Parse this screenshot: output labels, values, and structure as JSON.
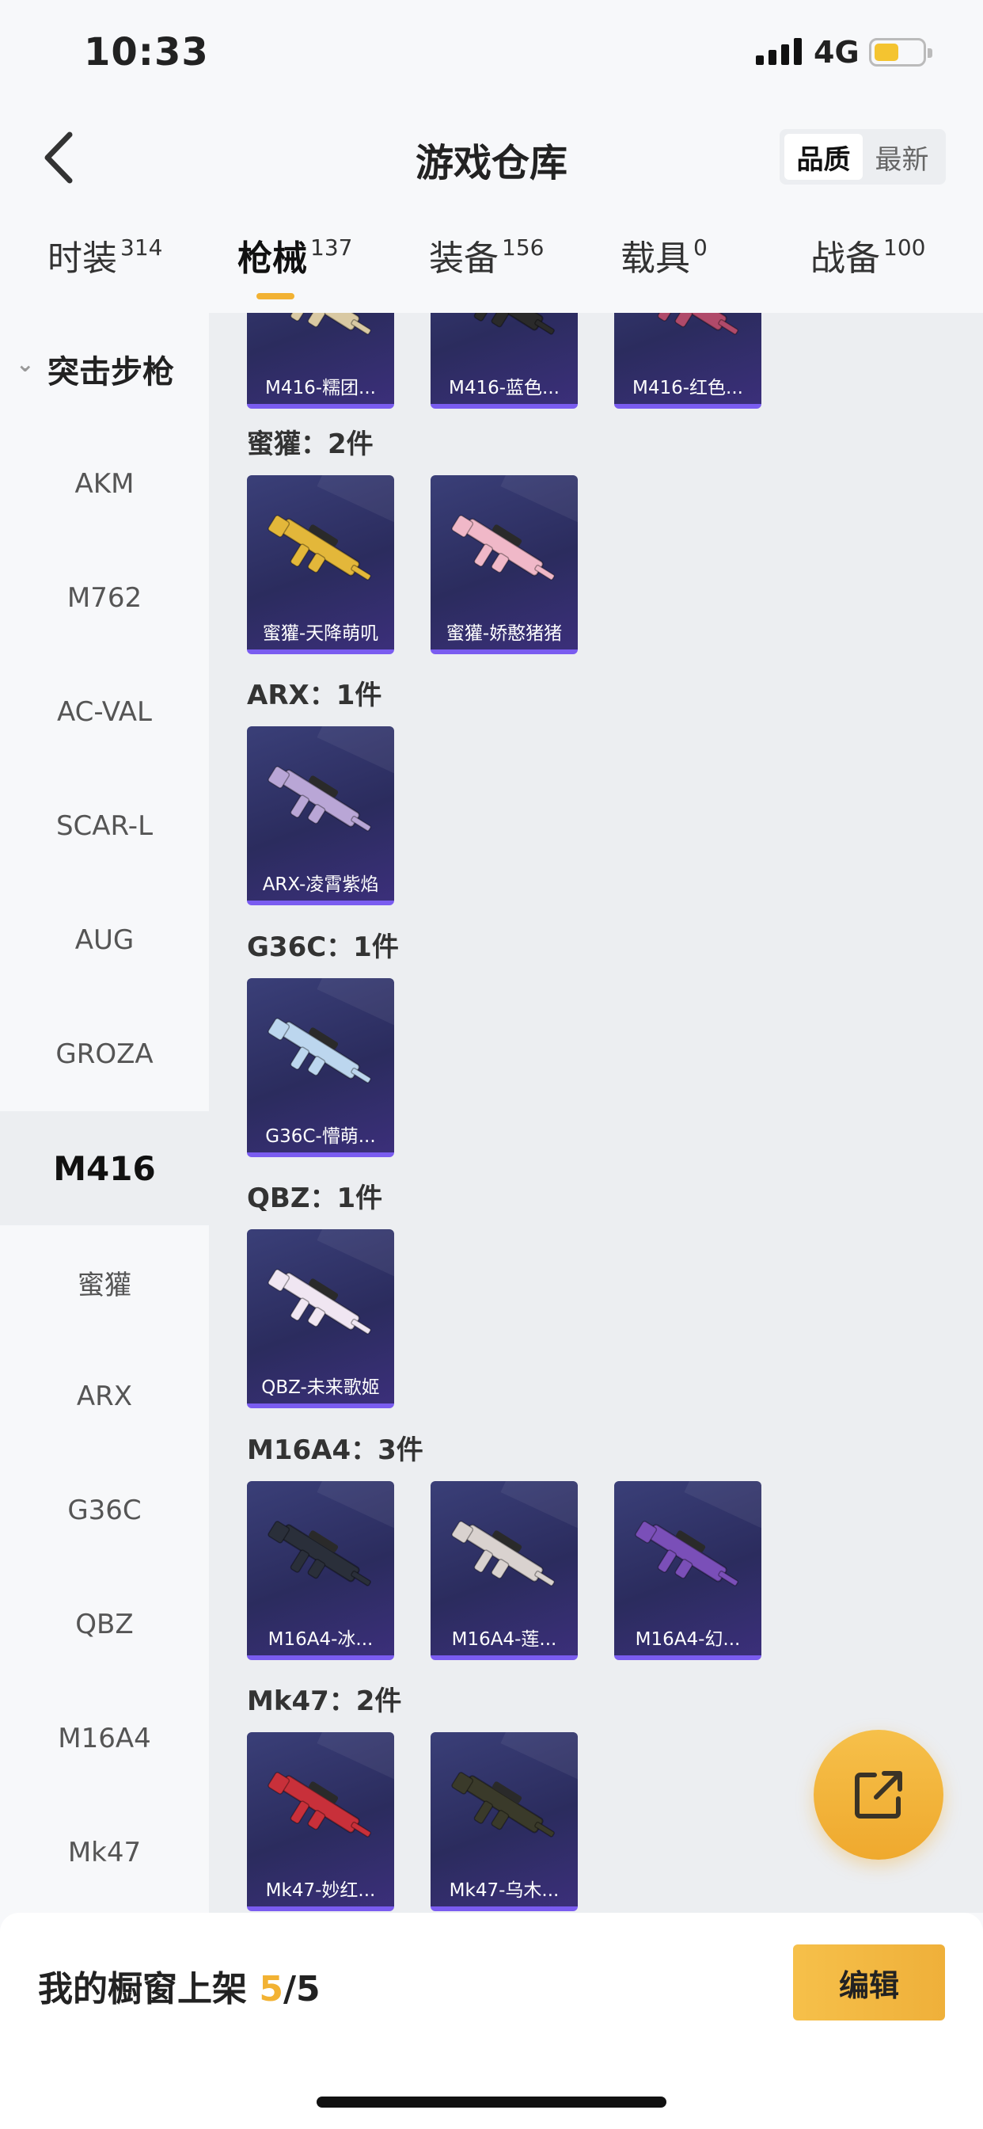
{
  "status_bar": {
    "time": "10:33",
    "network": "4G"
  },
  "header": {
    "title": "游戏仓库",
    "sort_options": [
      "品质",
      "最新"
    ],
    "sort_active": "品质"
  },
  "tabs": [
    {
      "label": "时装",
      "count": "314"
    },
    {
      "label": "枪械",
      "count": "137"
    },
    {
      "label": "装备",
      "count": "156"
    },
    {
      "label": "载具",
      "count": "0"
    },
    {
      "label": "战备",
      "count": "100"
    }
  ],
  "sidebar": {
    "group": "突击步枪",
    "items": [
      "AKM",
      "M762",
      "AC-VAL",
      "SCAR-L",
      "AUG",
      "GROZA",
      "M416",
      "蜜獾",
      "ARX",
      "G36C",
      "QBZ",
      "M16A4",
      "Mk47"
    ],
    "active": "M416"
  },
  "sections": [
    {
      "title": "",
      "items": [
        "M416-糯团...",
        "M416-蓝色...",
        "M416-红色..."
      ]
    },
    {
      "title": "蜜獾：2件",
      "items": [
        "蜜獾-天降萌叽",
        "蜜獾-娇憨猪猪"
      ]
    },
    {
      "title": "ARX：1件",
      "items": [
        "ARX-凌霄紫焰"
      ]
    },
    {
      "title": "G36C：1件",
      "items": [
        "G36C-懵萌..."
      ]
    },
    {
      "title": "QBZ：1件",
      "items": [
        "QBZ-未来歌姬"
      ]
    },
    {
      "title": "M16A4：3件",
      "items": [
        "M16A4-冰...",
        "M16A4-莲...",
        "M16A4-幻..."
      ]
    },
    {
      "title": "Mk47：2件",
      "items": [
        "Mk47-妙红...",
        "Mk47-乌木..."
      ]
    }
  ],
  "gun_colors": [
    "#d9c9a3",
    "#2a2a2a",
    "#b04a6a",
    "#e3b73a",
    "#f0b8c8",
    "#b9a6d6",
    "#bcd6ee",
    "#f0e6f2",
    "#2a2f3a",
    "#d9d2cf",
    "#7a4fb8",
    "#c8303a",
    "#3a3a2a"
  ],
  "bottom": {
    "showcase_label": "我的橱窗上架",
    "showcase_current": "5",
    "showcase_total": "/5",
    "edit_label": "编辑"
  },
  "colors": {
    "accent": "#f2b233",
    "card_bottom": "#7a5cf0"
  }
}
